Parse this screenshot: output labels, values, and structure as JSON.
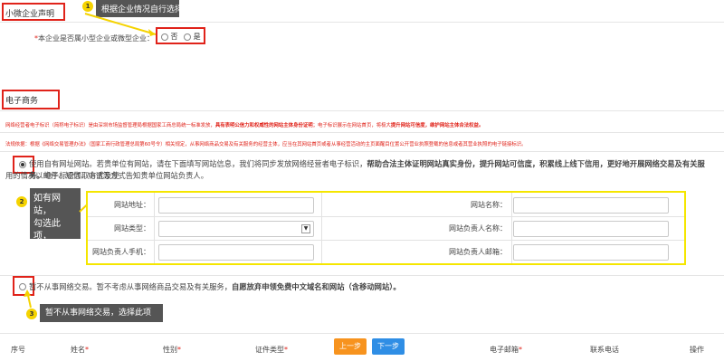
{
  "section_sme": {
    "title": "小微企业声明",
    "question_required": "*",
    "question": "本企业是否属小型企业或微型企业：",
    "option_no": "否",
    "option_yes": "是"
  },
  "callouts": {
    "c1_num": "1",
    "c1_text": "根据企业情况自行选择",
    "c2_num": "2",
    "c2_line1": "如有网站，",
    "c2_line2": "勾选此项，",
    "c2_line3": "填写信息",
    "c3_num": "3",
    "c3_text": "暂不从事网络交易，选择此项"
  },
  "section_ecommerce": {
    "title": "电子商务",
    "notice1_a": "网络经营者电子标识（简称电子标识）是由深圳市场监督管理局根据国家工商总局统一标准发放，",
    "notice1_b": "具有表明公信力和权威性的网站主体身份证明",
    "notice1_c": "；电子标识展示在网站首页，将极大",
    "notice1_d": "提升网站可信度，维护网站主体合法权益。",
    "notice2": "法规依据：根据《网络交易管理办法》（国家工商行政管理总局第60号令）相关规定，从事网络商品交易及有关服务的经营主体，应当在其网站首页或者从事经营活动的主页面醒目位置公开营业执照登载的信息或者其营业执照的电子链接标识。",
    "opt_has_site_a": "使用自有网址网站。若贵单位有网站，请在下面填写网站信息，我们将同步发放网络经营者电子标识，",
    "opt_has_site_b": "帮助合法主体证明网站真实身份，提升网站可信度，积累线上线下信用，更好地开展网络交易及有关服务。",
    "opt_has_site_c": "电子标识领取方式及使",
    "opt_has_site_d": "用的情况以邮件、短信、电话等方式告知贵单位网站负责人。",
    "opt_no_site_a": "暂不从事网络交易。暂不考虑从事网络商品交易及有关服务，",
    "opt_no_site_b": "自愿放弃申领免费中文域名和网站（含移动网站）。"
  },
  "site_form": {
    "url_label": "网站地址：",
    "name_label": "网站名称：",
    "type_label": "网站类型：",
    "owner_label": "网站负责人名称：",
    "owner_phone_label": "网站负责人手机：",
    "owner_email_label": "网站负责人邮箱：",
    "url_value": "",
    "name_value": "",
    "type_value": "",
    "owner_value": "",
    "phone_value": "",
    "email_value": ""
  },
  "member_table": {
    "col_no": "序号",
    "col_name": "姓名",
    "col_gender": "性别",
    "col_id_type": "证件类型",
    "prev_button": "上一步",
    "next_button": "下一步",
    "col_email": "电子邮箱",
    "col_phone": "联系电话",
    "col_action": "操作",
    "required_mark": "*"
  },
  "colors": {
    "red": "#e0231a",
    "callout_bg": "#555555",
    "badge": "#f5d300",
    "highlight_border": "#f5e600",
    "prev_button": "#f7931e",
    "next_button": "#2f8ee5"
  }
}
